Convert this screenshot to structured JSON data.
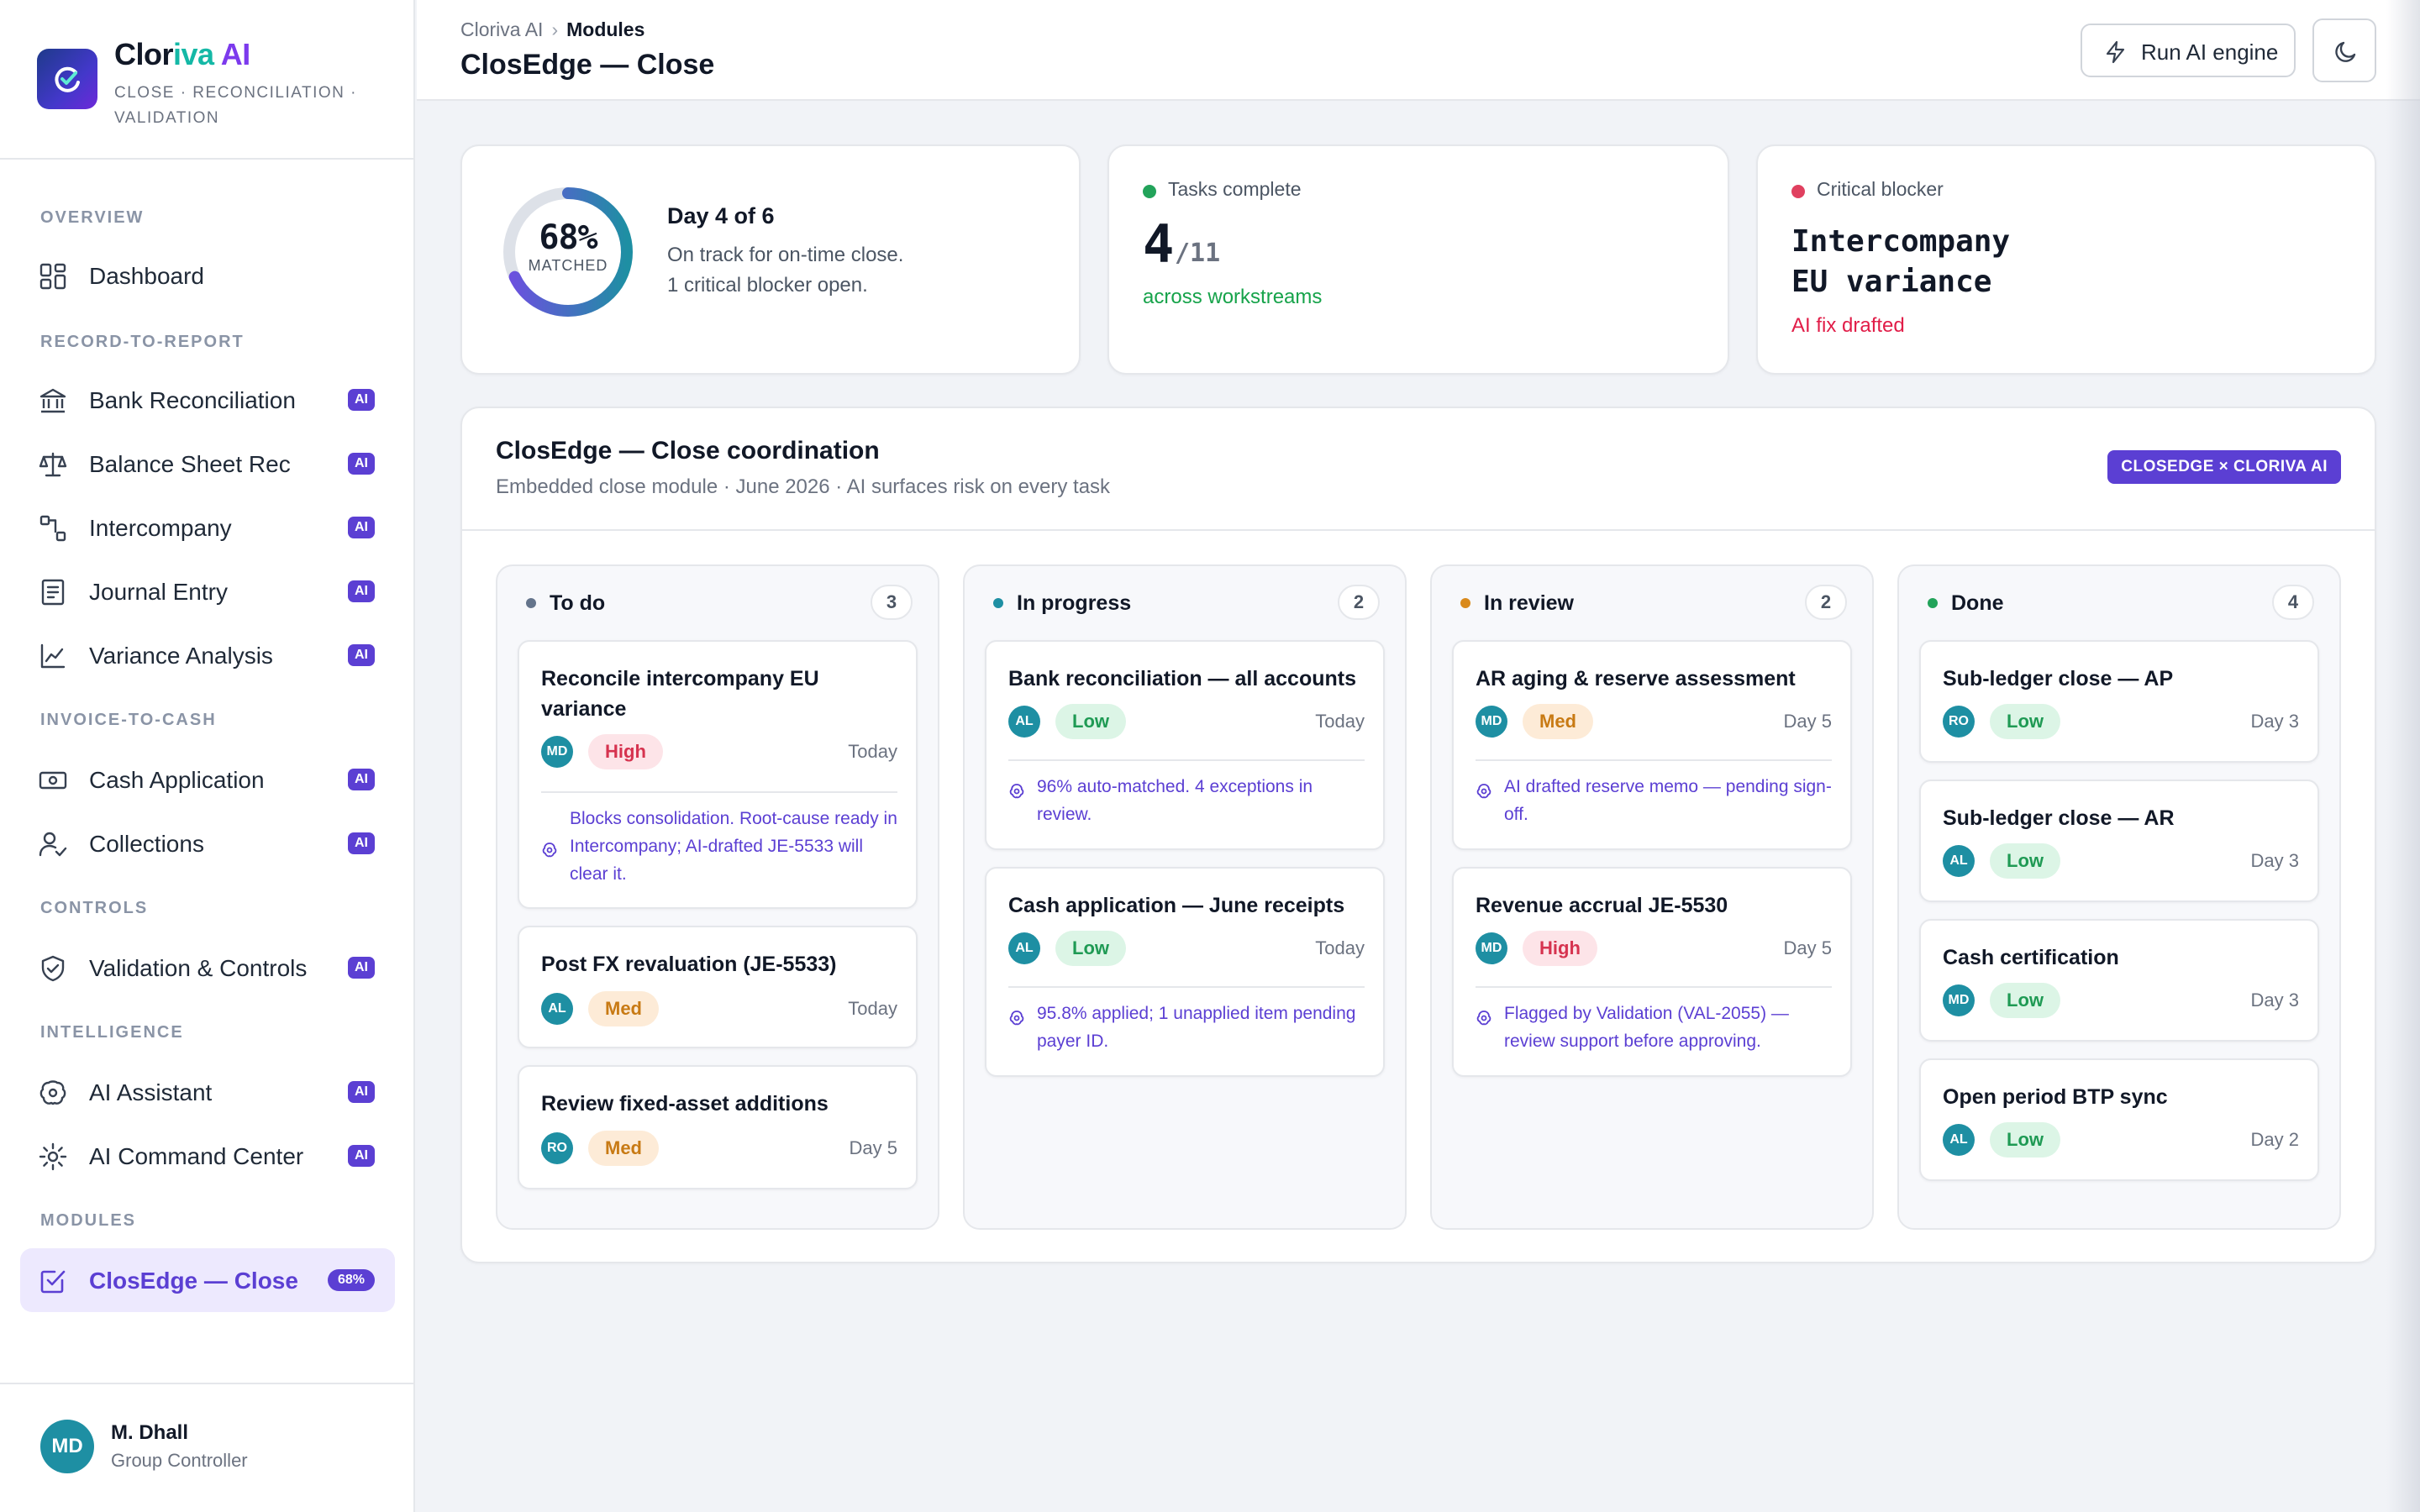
{
  "brand": {
    "name_part1": "Clor",
    "name_part2": "iva",
    "name_part3": " AI",
    "subtitle": "CLOSE · RECONCILIATION · VALIDATION"
  },
  "sidebar": {
    "sections": {
      "overview": "OVERVIEW",
      "r2r": "RECORD-TO-REPORT",
      "i2c": "INVOICE-TO-CASH",
      "controls": "CONTROLS",
      "intelligence": "INTELLIGENCE",
      "modules": "MODULES"
    },
    "items": {
      "dashboard": "Dashboard",
      "bank": "Bank Reconciliation",
      "balance": "Balance Sheet Rec",
      "interco": "Intercompany",
      "journal": "Journal Entry",
      "variance": "Variance Analysis",
      "cash": "Cash Application",
      "collections": "Collections",
      "validation": "Validation & Controls",
      "assistant": "AI Assistant",
      "command": "AI Command Center",
      "closedge": "ClosEdge — Close"
    },
    "ai_badge": "AI",
    "closedge_badge": "68%",
    "user": {
      "initials": "MD",
      "name": "M. Dhall",
      "role": "Group Controller"
    }
  },
  "header": {
    "crumb_root": "Cloriva AI",
    "crumb_sep": "›",
    "crumb_current": "Modules",
    "title": "ClosEdge — Close",
    "run_button": "Run AI engine"
  },
  "kpis": {
    "progress": {
      "percent_value": 68,
      "percent": "68%",
      "label": "MATCHED",
      "heading": "Day 4 of 6",
      "line1": "On track for on-time close.",
      "line2": "1 critical blocker open."
    },
    "tasks": {
      "label": "Tasks complete",
      "done": "4",
      "total": "/11",
      "footer": "across workstreams",
      "dot_color": "#22a35a"
    },
    "blocker": {
      "label": "Critical blocker",
      "line1": "Intercompany",
      "line2": "EU variance",
      "footer": "AI fix drafted",
      "dot_color": "#e0405f"
    }
  },
  "panel": {
    "title": "ClosEdge — Close coordination",
    "subtitle": "Embedded close module · June 2026 · AI surfaces risk on every task",
    "badge": "CLOSEDGE × CLORIVA AI"
  },
  "colors": {
    "accent": "#5b3fd3",
    "teal": "#1e8fa3"
  },
  "columns": [
    {
      "title": "To do",
      "count": "3",
      "dot": "#64748b",
      "tasks": [
        {
          "title": "Reconcile intercompany EU variance",
          "owner": "MD",
          "priority": "High",
          "due": "Today",
          "note": "Blocks consolidation. Root-cause ready in Intercompany; AI-drafted JE-5533 will clear it."
        },
        {
          "title": "Post FX revaluation (JE-5533)",
          "owner": "AL",
          "priority": "Med",
          "due": "Today"
        },
        {
          "title": "Review fixed-asset additions",
          "owner": "RO",
          "priority": "Med",
          "due": "Day 5"
        }
      ]
    },
    {
      "title": "In progress",
      "count": "2",
      "dot": "#1e8fa3",
      "tasks": [
        {
          "title": "Bank reconciliation — all accounts",
          "owner": "AL",
          "priority": "Low",
          "due": "Today",
          "note": "96% auto-matched. 4 exceptions in review."
        },
        {
          "title": "Cash application — June receipts",
          "owner": "AL",
          "priority": "Low",
          "due": "Today",
          "note": "95.8% applied; 1 unapplied item pending payer ID."
        }
      ]
    },
    {
      "title": "In review",
      "count": "2",
      "dot": "#d98a1c",
      "tasks": [
        {
          "title": "AR aging & reserve assessment",
          "owner": "MD",
          "priority": "Med",
          "due": "Day 5",
          "note": "AI drafted reserve memo — pending sign-off."
        },
        {
          "title": "Revenue accrual JE-5530",
          "owner": "MD",
          "priority": "High",
          "due": "Day 5",
          "note": "Flagged by Validation (VAL-2055) — review support before approving."
        }
      ]
    },
    {
      "title": "Done",
      "count": "4",
      "dot": "#22a35a",
      "tasks": [
        {
          "title": "Sub-ledger close — AP",
          "owner": "RO",
          "priority": "Low",
          "due": "Day 3"
        },
        {
          "title": "Sub-ledger close — AR",
          "owner": "AL",
          "priority": "Low",
          "due": "Day 3"
        },
        {
          "title": "Cash certification",
          "owner": "MD",
          "priority": "Low",
          "due": "Day 3"
        },
        {
          "title": "Open period BTP sync",
          "owner": "AL",
          "priority": "Low",
          "due": "Day 2"
        }
      ]
    }
  ]
}
